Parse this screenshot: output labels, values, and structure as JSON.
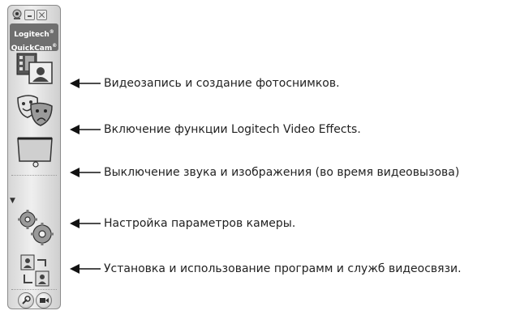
{
  "app": {
    "brand_line1": "Logitech",
    "brand_line2": "QuickCam",
    "brand_mark": "®"
  },
  "toolbar": {
    "title_icons": [
      "webcam-icon",
      "minimize-icon",
      "close-icon"
    ],
    "tools": [
      {
        "name": "video-capture",
        "icon": "film-photo-icon"
      },
      {
        "name": "video-effects",
        "icon": "theater-masks-icon"
      },
      {
        "name": "privacy-shade",
        "icon": "shade-screen-icon"
      },
      {
        "name": "camera-settings",
        "icon": "gears-icon"
      },
      {
        "name": "video-services",
        "icon": "contacts-exchange-icon"
      }
    ],
    "bottom_buttons": [
      "wrench-icon",
      "record-icon"
    ]
  },
  "callouts": [
    "Видеозапись и создание фотоснимков.",
    "Включение функции Logitech Video Effects.",
    "Выключение звука и изображения (во время видеовызова)",
    "Настройка параметров камеры.",
    "Установка и использование программ и служб видеосвязи."
  ]
}
